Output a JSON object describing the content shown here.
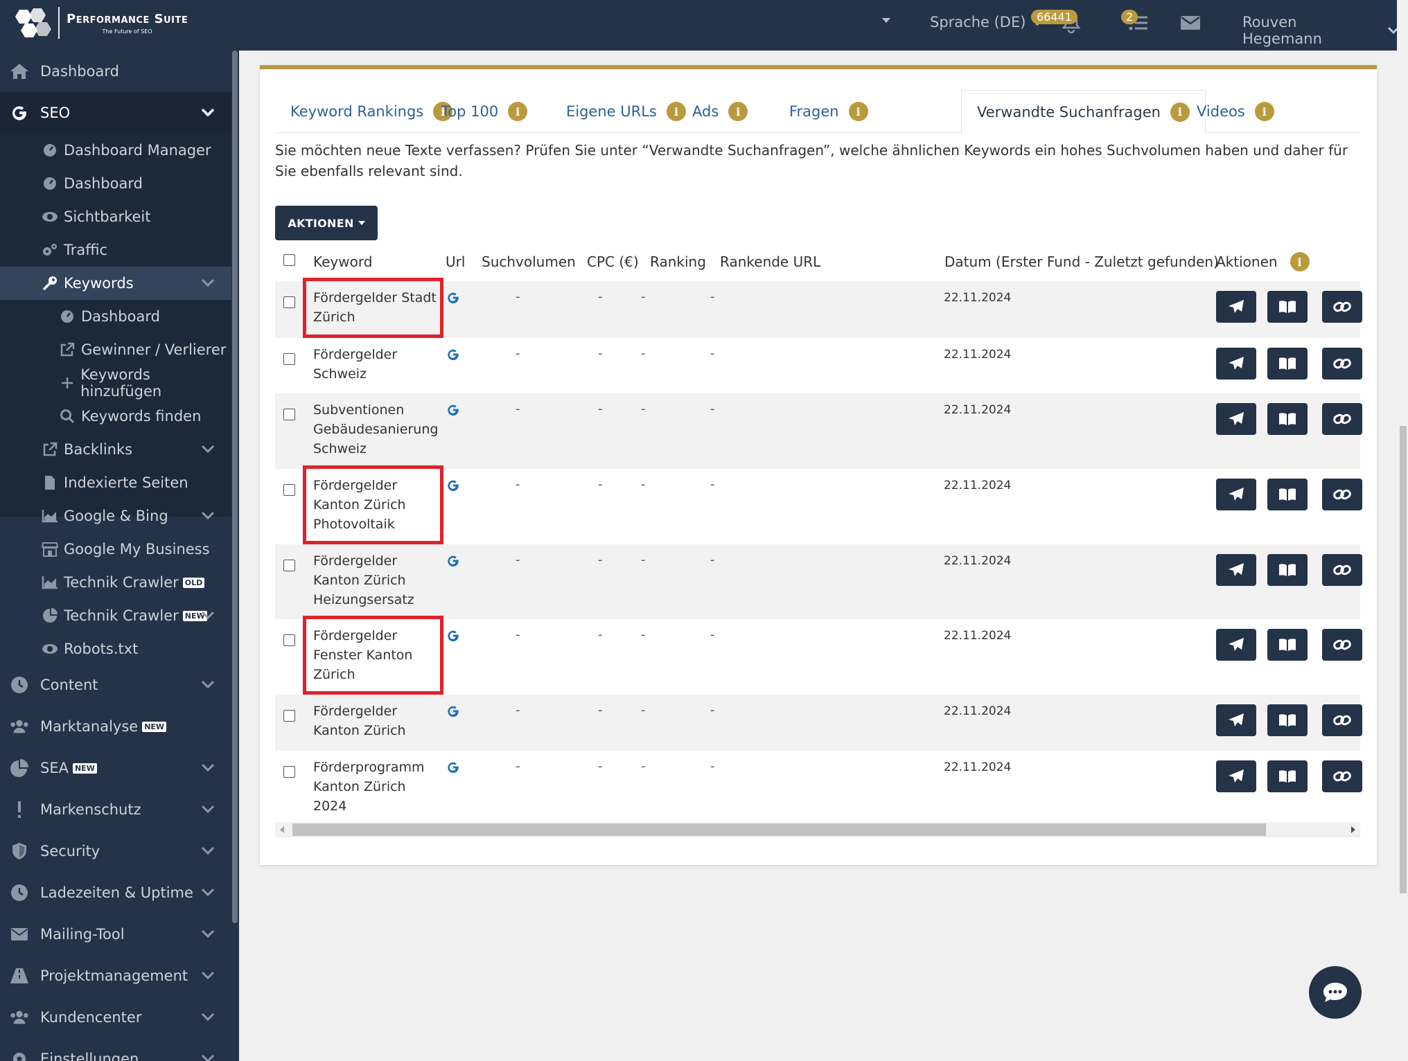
{
  "app": {
    "brand": "Performance Suite",
    "tagline": "The Future of SEO"
  },
  "topbar": {
    "language": "Sprache (DE)",
    "credits_badge": "66441",
    "tasks_badge": "2",
    "user": "Rouven Hegemann"
  },
  "sidebar": {
    "dashboard": "Dashboard",
    "seo": "SEO",
    "seo_items": {
      "dashboard_manager": "Dashboard Manager",
      "dashboard": "Dashboard",
      "sichtbarkeit": "Sichtbarkeit",
      "traffic": "Traffic",
      "keywords": "Keywords",
      "kw_dashboard": "Dashboard",
      "kw_gewinner": "Gewinner / Verlierer",
      "kw_add": "Keywords hinzufügen",
      "kw_find": "Keywords finden",
      "backlinks": "Backlinks",
      "indexierte": "Indexierte Seiten",
      "google_bing": "Google & Bing",
      "gmb": "Google My Business",
      "crawler_old": "Technik Crawler",
      "crawler_old_tag": "OLD",
      "crawler_new": "Technik Crawler",
      "crawler_new_tag": "NEW",
      "robots": "Robots.txt"
    },
    "content": "Content",
    "marktanalyse": "Marktanalyse",
    "marktanalyse_tag": "NEW",
    "sea": "SEA",
    "sea_tag": "NEW",
    "markenschutz": "Markenschutz",
    "security": "Security",
    "ladezeiten": "Ladezeiten & Uptime",
    "mailing": "Mailing-Tool",
    "projekt": "Projektmanagement",
    "kunden": "Kundencenter",
    "einstellungen": "Einstellungen"
  },
  "tabs": [
    {
      "label": "Keyword Rankings"
    },
    {
      "label": "Top 100"
    },
    {
      "label": "Eigene URLs"
    },
    {
      "label": "Ads"
    },
    {
      "label": "Fragen"
    },
    {
      "label": "Verwandte Suchanfragen"
    },
    {
      "label": "Videos"
    }
  ],
  "description": "Sie möchten neue Texte verfassen? Prüfen Sie unter “Verwandte Suchanfragen”, welche ähnlichen Keywords ein hohes Suchvolumen haben und daher für Sie ebenfalls relevant sind.",
  "actions_button": "AKTIONEN",
  "table": {
    "headers": {
      "keyword": "Keyword",
      "url": "Url",
      "volume": "Suchvolumen",
      "cpc": "CPC (€)",
      "ranking": "Ranking",
      "ranking_url": "Rankende URL",
      "date": "Datum (Erster Fund - Zuletzt gefunden)",
      "actions": "Aktionen"
    },
    "rows": [
      {
        "keyword": "Fördergelder Stadt Zürich",
        "volume": "-",
        "cpc": "-",
        "ranking": "-",
        "url": "-",
        "date": "22.11.2024"
      },
      {
        "keyword": "Fördergelder Schweiz",
        "volume": "-",
        "cpc": "-",
        "ranking": "-",
        "url": "-",
        "date": "22.11.2024"
      },
      {
        "keyword": "Subventionen Gebäudesanierung Schweiz",
        "volume": "-",
        "cpc": "-",
        "ranking": "-",
        "url": "-",
        "date": "22.11.2024"
      },
      {
        "keyword": "Fördergelder Kanton Zürich Photovoltaik",
        "volume": "-",
        "cpc": "-",
        "ranking": "-",
        "url": "-",
        "date": "22.11.2024"
      },
      {
        "keyword": "Fördergelder Kanton Zürich Heizungsersatz",
        "volume": "-",
        "cpc": "-",
        "ranking": "-",
        "url": "-",
        "date": "22.11.2024"
      },
      {
        "keyword": "Fördergelder Fenster Kanton Zürich",
        "volume": "-",
        "cpc": "-",
        "ranking": "-",
        "url": "-",
        "date": "22.11.2024"
      },
      {
        "keyword": "Fördergelder Kanton Zürich",
        "volume": "-",
        "cpc": "-",
        "ranking": "-",
        "url": "-",
        "date": "22.11.2024"
      },
      {
        "keyword": "Förderprogramm Kanton Zürich 2024",
        "volume": "-",
        "cpc": "-",
        "ranking": "-",
        "url": "-",
        "date": "22.11.2024"
      }
    ]
  },
  "colors": {
    "navy": "#243347",
    "gold": "#b99a3e",
    "link": "#2f5f98",
    "highlight": "#e0222b"
  }
}
